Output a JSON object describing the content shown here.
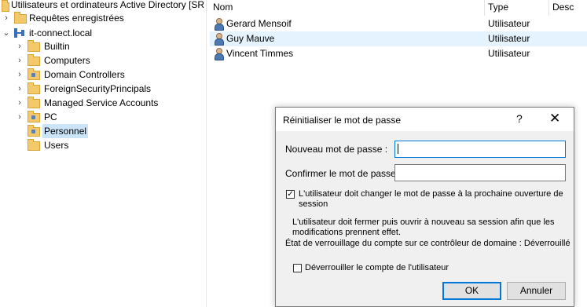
{
  "tree": {
    "root_label": "Utilisateurs et ordinateurs Active Directory [SR",
    "saved_queries": "Requêtes enregistrées",
    "domain": "it-connect.local",
    "items": [
      {
        "label": "Builtin"
      },
      {
        "label": "Computers"
      },
      {
        "label": "Domain Controllers"
      },
      {
        "label": "ForeignSecurityPrincipals"
      },
      {
        "label": "Managed Service Accounts"
      },
      {
        "label": "PC"
      },
      {
        "label": "Personnel"
      },
      {
        "label": "Users"
      }
    ],
    "selected": "Personnel"
  },
  "list": {
    "columns": {
      "name": "Nom",
      "type": "Type",
      "desc": "Desc"
    },
    "rows": [
      {
        "name": "Gerard Mensoif",
        "type": "Utilisateur"
      },
      {
        "name": "Guy Mauve",
        "type": "Utilisateur"
      },
      {
        "name": "Vincent Timmes",
        "type": "Utilisateur"
      }
    ]
  },
  "dialog": {
    "title": "Réinitialiser le mot de passe",
    "help_glyph": "?",
    "close_glyph": "✕",
    "new_password_label": "Nouveau mot de passe :",
    "new_password_value": "",
    "confirm_password_label": "Confirmer le mot de passe :",
    "confirm_password_value": "",
    "must_change_label_line1": "L'utilisateur doit changer le mot de passe à la prochaine ouverture de",
    "must_change_label_line2": "session",
    "must_change_checked": true,
    "info_line1": "L'utilisateur doit fermer puis ouvrir à nouveau sa session afin que les",
    "info_line2": "modifications prennent effet.",
    "lock_status": "État de verrouillage du compte sur ce contrôleur de domaine : Déverrouillé",
    "unlock_label": "Déverrouiller le compte de l'utilisateur",
    "unlock_checked": false,
    "ok_label": "OK",
    "cancel_label": "Annuler",
    "check_glyph": "✓"
  }
}
